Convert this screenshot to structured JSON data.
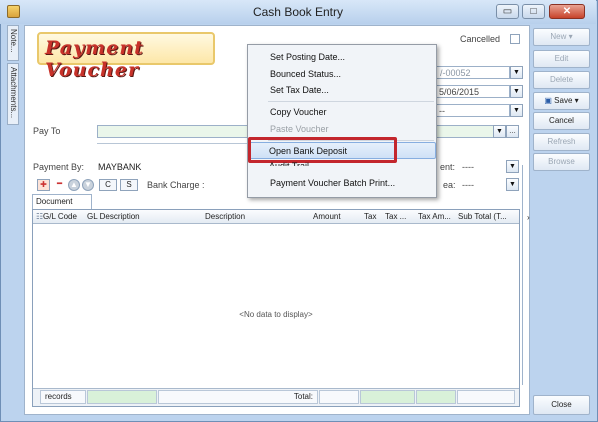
{
  "window": {
    "title": "Cash Book Entry",
    "minimize": "▭",
    "maximize": "□",
    "close": "✕"
  },
  "side_tabs": [
    "Note...",
    "Attachments..."
  ],
  "voucher": {
    "logo_text": "Payment Voucher",
    "cancelled_label": "Cancelled",
    "doc_no_partial": "/-00052",
    "date_partial": "5/06/2015",
    "combo3_value": "--",
    "pay_to_label": "Pay To",
    "payment_by_label": "Payment By:",
    "payment_by_value": "MAYBANK",
    "right_label_1": "ent:",
    "right_value_1": "----",
    "right_label_2": "ea:",
    "right_value_2": "----",
    "bank_charge_label": "Bank Charge :",
    "btn_c": "C",
    "btn_s": "S"
  },
  "grid": {
    "tab_label": "Document Detail Grid",
    "columns": [
      "G/L Code",
      "GL Description",
      "Description",
      "Amount",
      "Tax",
      "Tax ...",
      "Tax Am...",
      "Sub Total (T..."
    ],
    "empty_text": "<No data to display>",
    "footer_records": "records",
    "footer_total": "Total:"
  },
  "actions": {
    "new": "New",
    "edit": "Edit",
    "delete": "Delete",
    "save": "Save",
    "cancel": "Cancel",
    "refresh": "Refresh",
    "browse": "Browse",
    "close": "Close"
  },
  "context_menu": {
    "items": [
      {
        "label": "Set Posting Date...",
        "enabled": true
      },
      {
        "label": "Bounced Status...",
        "enabled": true
      },
      {
        "label": "Set Tax Date...",
        "enabled": true
      },
      {
        "label": "Copy Voucher",
        "enabled": true
      },
      {
        "label": "Paste Voucher",
        "enabled": false
      },
      {
        "label": "Open Bank Deposit",
        "enabled": true,
        "highlighted": true
      },
      {
        "label": "Audit Trail",
        "enabled": true
      },
      {
        "label": "Payment Voucher Batch Print...",
        "enabled": true
      }
    ]
  },
  "colors": {
    "highlight_box": "#c3262d",
    "logo_text": "#c8322a",
    "field_green": "#eaf6ea"
  }
}
